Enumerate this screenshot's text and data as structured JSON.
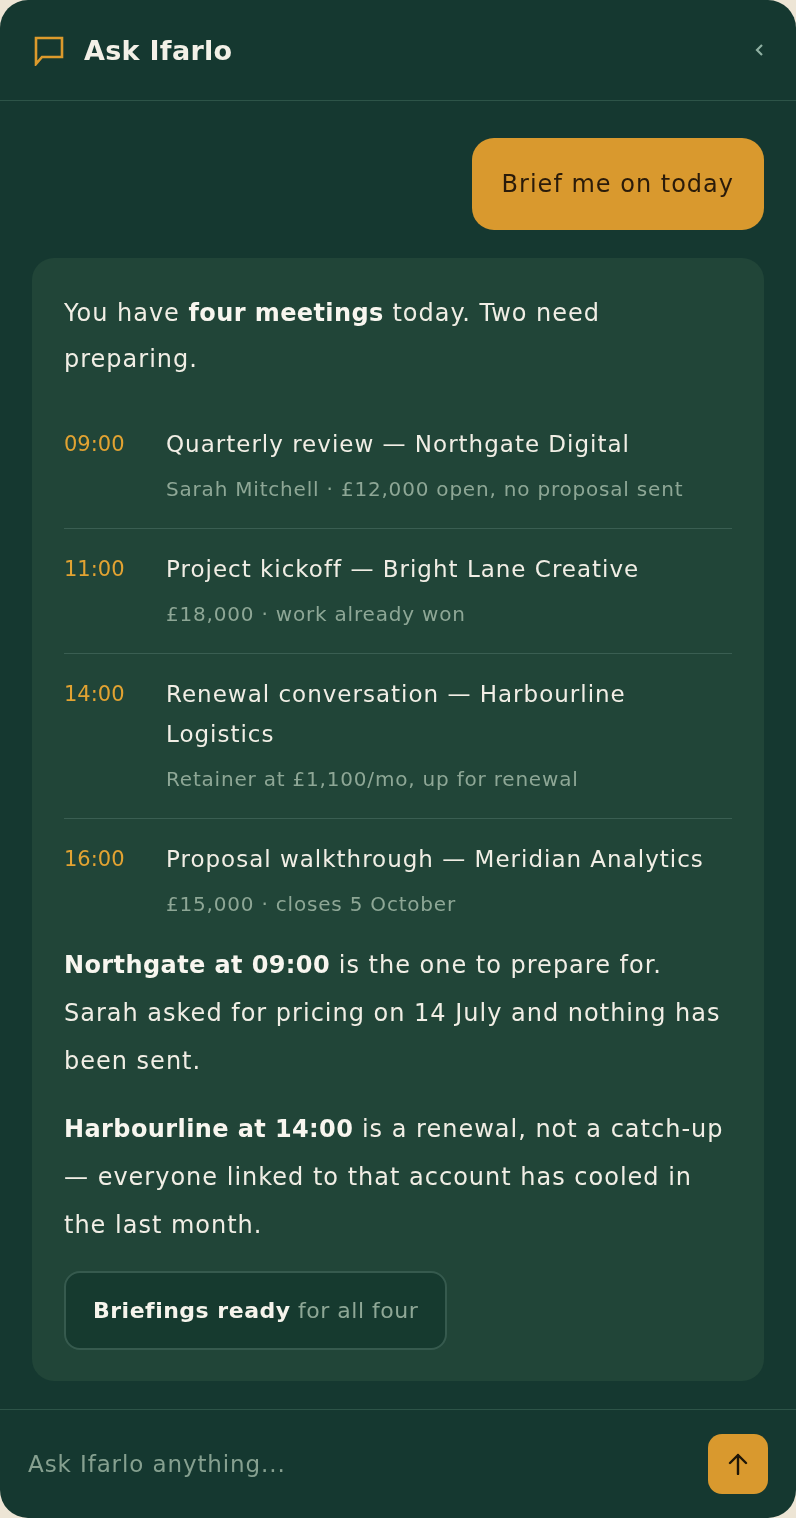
{
  "header": {
    "title": "Ask Ifarlo"
  },
  "messages": [
    {
      "kind": "user",
      "text": "Brief me on today"
    },
    {
      "kind": "assistant",
      "intro": "You have **four meetings** today. Two need preparing.",
      "meetings": [
        {
          "time": "09:00",
          "title": "Quarterly review — Northgate Digital",
          "detail": "Sarah Mitchell · £12,000 open, no proposal sent"
        },
        {
          "time": "11:00",
          "title": "Project kickoff — Bright Lane Creative",
          "detail": "£18,000 · work already won"
        },
        {
          "time": "14:00",
          "title": "Renewal conversation — Harbourline Logistics",
          "detail": "Retainer at £1,100/mo, up for renewal"
        },
        {
          "time": "16:00",
          "title": "Proposal walkthrough — Meridian Analytics",
          "detail": "£15,000 · closes 5 October"
        }
      ],
      "paragraphs": [
        "**Northgate at 09:00** is the one to prepare for. Sarah asked for pricing on 14 July and nothing has been sent.",
        "**Harbourline at 14:00** is a renewal, not a catch-up — everyone linked to that account has cooled in the last month."
      ],
      "action": "**Briefings ready** for all four"
    }
  ],
  "composer": {
    "placeholder": "Ask Ifarlo anything..."
  }
}
